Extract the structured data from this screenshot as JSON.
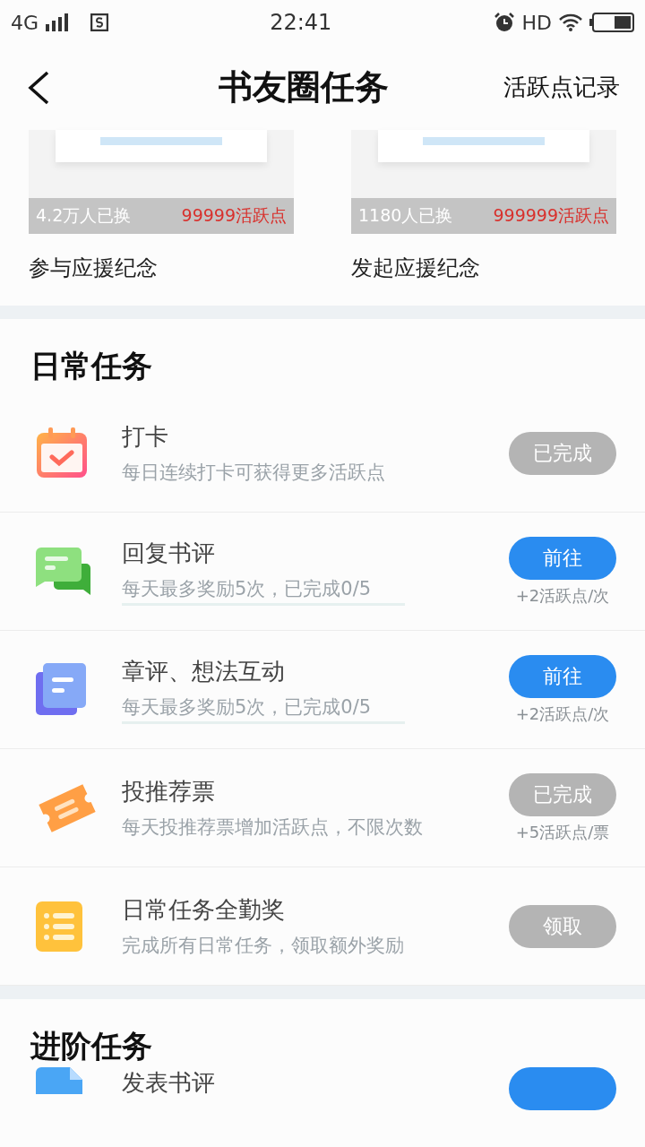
{
  "status_bar": {
    "network": "4G",
    "time": "22:41",
    "hd": "HD"
  },
  "header": {
    "title": "书友圈任务",
    "action": "活跃点记录"
  },
  "rewards": [
    {
      "count": "4.2万人已换",
      "price": "99999活跃点",
      "name": "参与应援纪念"
    },
    {
      "count": "1180人已换",
      "price": "999999活跃点",
      "name": "发起应援纪念"
    }
  ],
  "sections": [
    {
      "title": "日常任务",
      "tasks": [
        {
          "title": "打卡",
          "desc": "每日连续打卡可获得更多活跃点",
          "button": {
            "label": "已完成",
            "active": false
          }
        },
        {
          "title": "回复书评",
          "desc": "每天最多奖励5次，已完成0/5",
          "button": {
            "label": "前往",
            "active": true
          },
          "reward": "+2活跃点/次"
        },
        {
          "title": "章评、想法互动",
          "desc": "每天最多奖励5次，已完成0/5",
          "button": {
            "label": "前往",
            "active": true
          },
          "reward": "+2活跃点/次"
        },
        {
          "title": "投推荐票",
          "desc": "每天投推荐票增加活跃点，不限次数",
          "button": {
            "label": "已完成",
            "active": false
          },
          "reward": "+5活跃点/票"
        },
        {
          "title": "日常任务全勤奖",
          "desc": "完成所有日常任务，领取额外奖励",
          "button": {
            "label": "领取",
            "active": false
          }
        }
      ]
    },
    {
      "title": "进阶任务",
      "tasks": [
        {
          "title": "发表书评",
          "button": {
            "active": true
          }
        }
      ]
    }
  ]
}
